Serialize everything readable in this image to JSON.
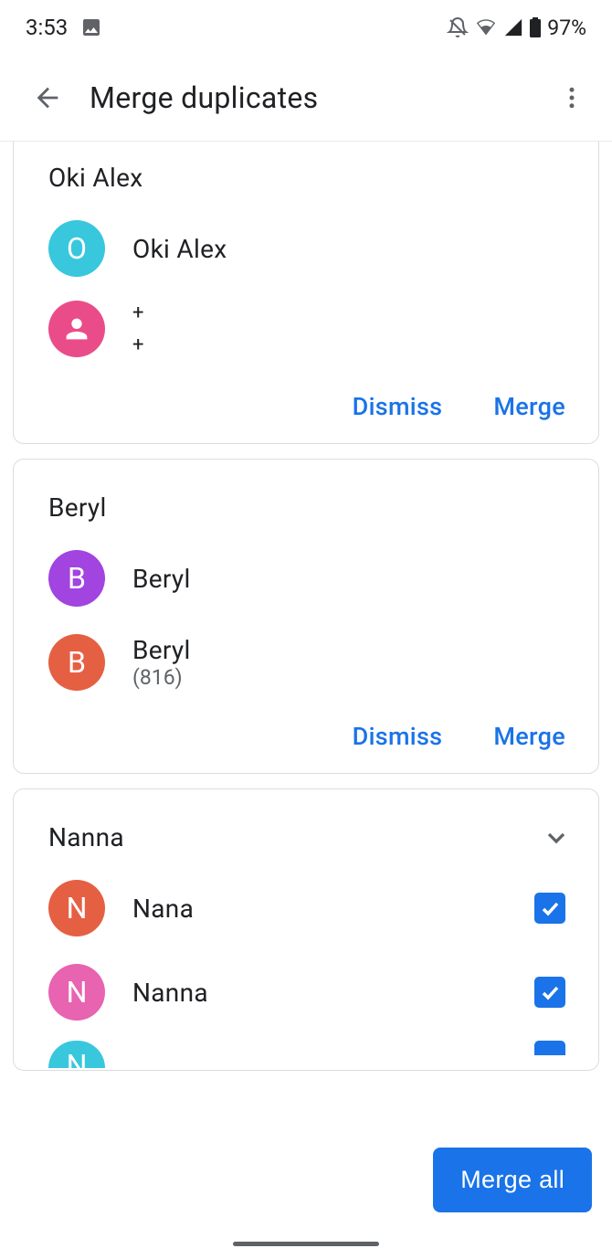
{
  "status_bar": {
    "time": "3:53",
    "battery_pct": "97%"
  },
  "header": {
    "title": "Merge duplicates"
  },
  "groups": [
    {
      "title": "Oki Alex",
      "expandable": false,
      "contacts": [
        {
          "avatar_letter": "O",
          "avatar_color": "#38c7dd",
          "avatar_type": "letter",
          "name": "Oki Alex",
          "sub": ""
        },
        {
          "avatar_letter": "",
          "avatar_color": "#ea4c89",
          "avatar_type": "person",
          "name": "",
          "sub": "",
          "plus_lines": [
            "+",
            "+"
          ]
        }
      ],
      "actions": {
        "dismiss": "Dismiss",
        "merge": "Merge"
      }
    },
    {
      "title": "Beryl",
      "expandable": false,
      "contacts": [
        {
          "avatar_letter": "B",
          "avatar_color": "#a144e0",
          "avatar_type": "letter",
          "name": "Beryl",
          "sub": ""
        },
        {
          "avatar_letter": "B",
          "avatar_color": "#e56043",
          "avatar_type": "letter",
          "name": "Beryl",
          "sub": "(816)"
        }
      ],
      "actions": {
        "dismiss": "Dismiss",
        "merge": "Merge"
      }
    },
    {
      "title": "Nanna",
      "expandable": true,
      "contacts": [
        {
          "avatar_letter": "N",
          "avatar_color": "#e56043",
          "avatar_type": "letter",
          "name": "Nana",
          "checked": true
        },
        {
          "avatar_letter": "N",
          "avatar_color": "#e863b0",
          "avatar_type": "letter",
          "name": "Nanna",
          "checked": true
        },
        {
          "avatar_letter": "N",
          "avatar_color": "#38c7dd",
          "avatar_type": "letter",
          "name": "",
          "checked": true,
          "partial": true
        }
      ]
    }
  ],
  "footer": {
    "merge_all": "Merge all"
  }
}
